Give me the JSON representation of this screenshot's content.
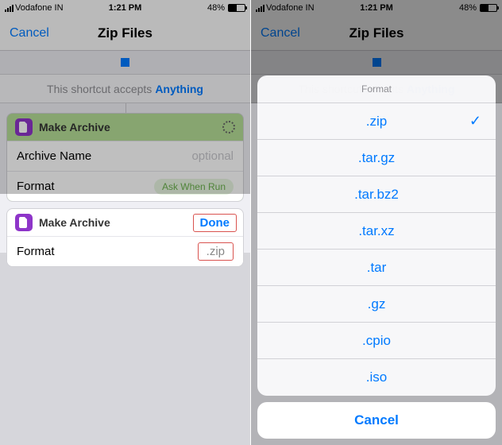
{
  "status": {
    "carrier": "Vodafone IN",
    "time": "1:21 PM",
    "battery_pct": "48%"
  },
  "nav": {
    "cancel": "Cancel",
    "title": "Zip Files"
  },
  "accepts": {
    "prefix": "This shortcut accepts",
    "link": "Anything"
  },
  "card_green": {
    "title": "Make Archive",
    "rows": {
      "archive_name_label": "Archive Name",
      "archive_name_placeholder": "optional",
      "format_label": "Format",
      "format_value": "Ask When Run"
    }
  },
  "card_white": {
    "title": "Make Archive",
    "done": "Done",
    "format_label": "Format",
    "format_value": ".zip"
  },
  "format_sheet": {
    "title": "Format",
    "options": [
      ".zip",
      ".tar.gz",
      ".tar.bz2",
      ".tar.xz",
      ".tar",
      ".gz",
      ".cpio",
      ".iso"
    ],
    "selected": ".zip",
    "cancel": "Cancel"
  }
}
